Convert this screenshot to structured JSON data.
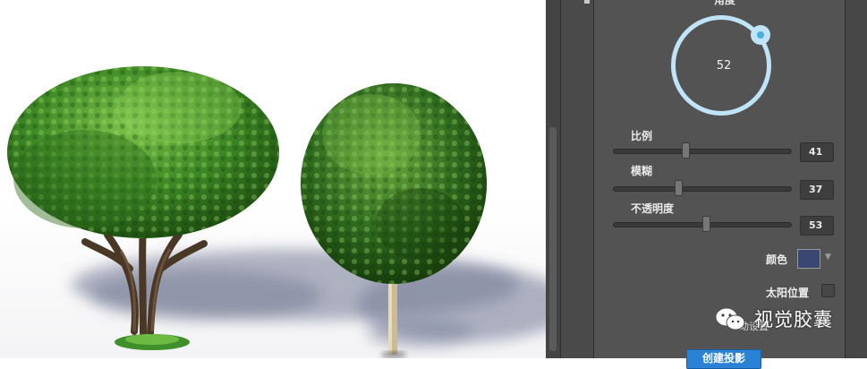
{
  "panel": {
    "dial": {
      "title": "角度",
      "value": "52"
    },
    "sliders": [
      {
        "label": "比例",
        "value": "41",
        "fraction": 0.41
      },
      {
        "label": "模糊",
        "value": "37",
        "fraction": 0.37
      },
      {
        "label": "不透明度",
        "value": "53",
        "fraction": 0.53
      }
    ],
    "color": {
      "label": "颜色",
      "swatch": "#3a4770",
      "arrow": "▼"
    },
    "sun_position": {
      "label": "太阳位置"
    },
    "hidden_label": "动设置",
    "create_button": "创建投影"
  },
  "watermark": {
    "text": "视觉胶囊",
    "icon": "wechat-icon"
  },
  "colors": {
    "panel_bg": "#535353",
    "dial_ring": "#bfe3f7",
    "accent_blue": "#2a82d6",
    "foliage_dark": "#2f6b1f",
    "foliage_light": "#5fa83a"
  }
}
